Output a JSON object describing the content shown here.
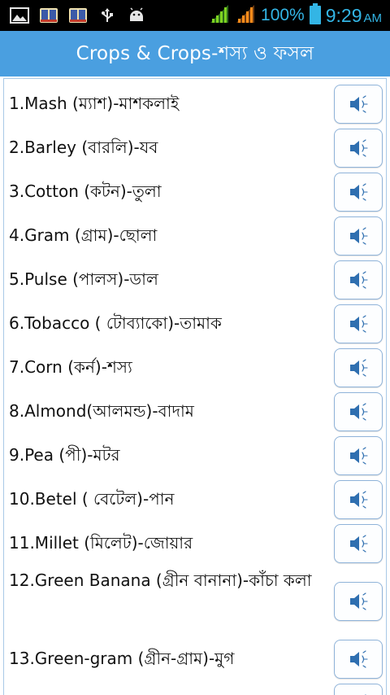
{
  "status_bar": {
    "battery_percent": "100%",
    "time": "9:29",
    "ampm": "AM",
    "icons": [
      "gallery-icon",
      "book-app-icon",
      "book-app-icon-2",
      "usb-icon",
      "android-icon",
      "signal-icon",
      "signal-icon-2",
      "battery-icon"
    ]
  },
  "app_bar": {
    "title": "Crops & Crops-শস্য ও ফসল"
  },
  "colors": {
    "app_bar": "#4a9fe0",
    "status_text": "#33b5e5",
    "button_border": "#8fb3d9",
    "speaker_icon": "#2f6fb0"
  },
  "items": [
    {
      "text": "1.Mash (ম্যাশ)-মাশকলাই",
      "icon": "speaker-icon"
    },
    {
      "text": "2.Barley (বারলি)-যব",
      "icon": "speaker-icon"
    },
    {
      "text": "3.Cotton (কটন)-তুলা",
      "icon": "speaker-icon"
    },
    {
      "text": "4.Gram (গ্রাম)-ছোলা",
      "icon": "speaker-icon"
    },
    {
      "text": "5.Pulse (পালস)-ডাল",
      "icon": "speaker-icon"
    },
    {
      "text": "6.Tobacco ( টোব্যাকো)-তামাক",
      "icon": "speaker-icon"
    },
    {
      "text": "7.Corn (কর্ন)-শস্য",
      "icon": "speaker-icon"
    },
    {
      "text": "8.Almond(আলমন্ড)-বাদাম",
      "icon": "speaker-icon"
    },
    {
      "text": "9.Pea (পী)-মটর",
      "icon": "speaker-icon"
    },
    {
      "text": "10.Betel ( বেটেল)-পান",
      "icon": "speaker-icon"
    },
    {
      "text": "11.Millet (মিলেট)-জোয়ার",
      "icon": "speaker-icon"
    },
    {
      "text": "12.Green Banana (গ্রীন বানানা)-কাঁচা কলা",
      "icon": "speaker-icon"
    },
    {
      "text": "13.Green-gram  (গ্রীন-গ্রাম)-মুগ",
      "icon": "speaker-icon"
    },
    {
      "text": "",
      "icon": "speaker-icon"
    }
  ]
}
